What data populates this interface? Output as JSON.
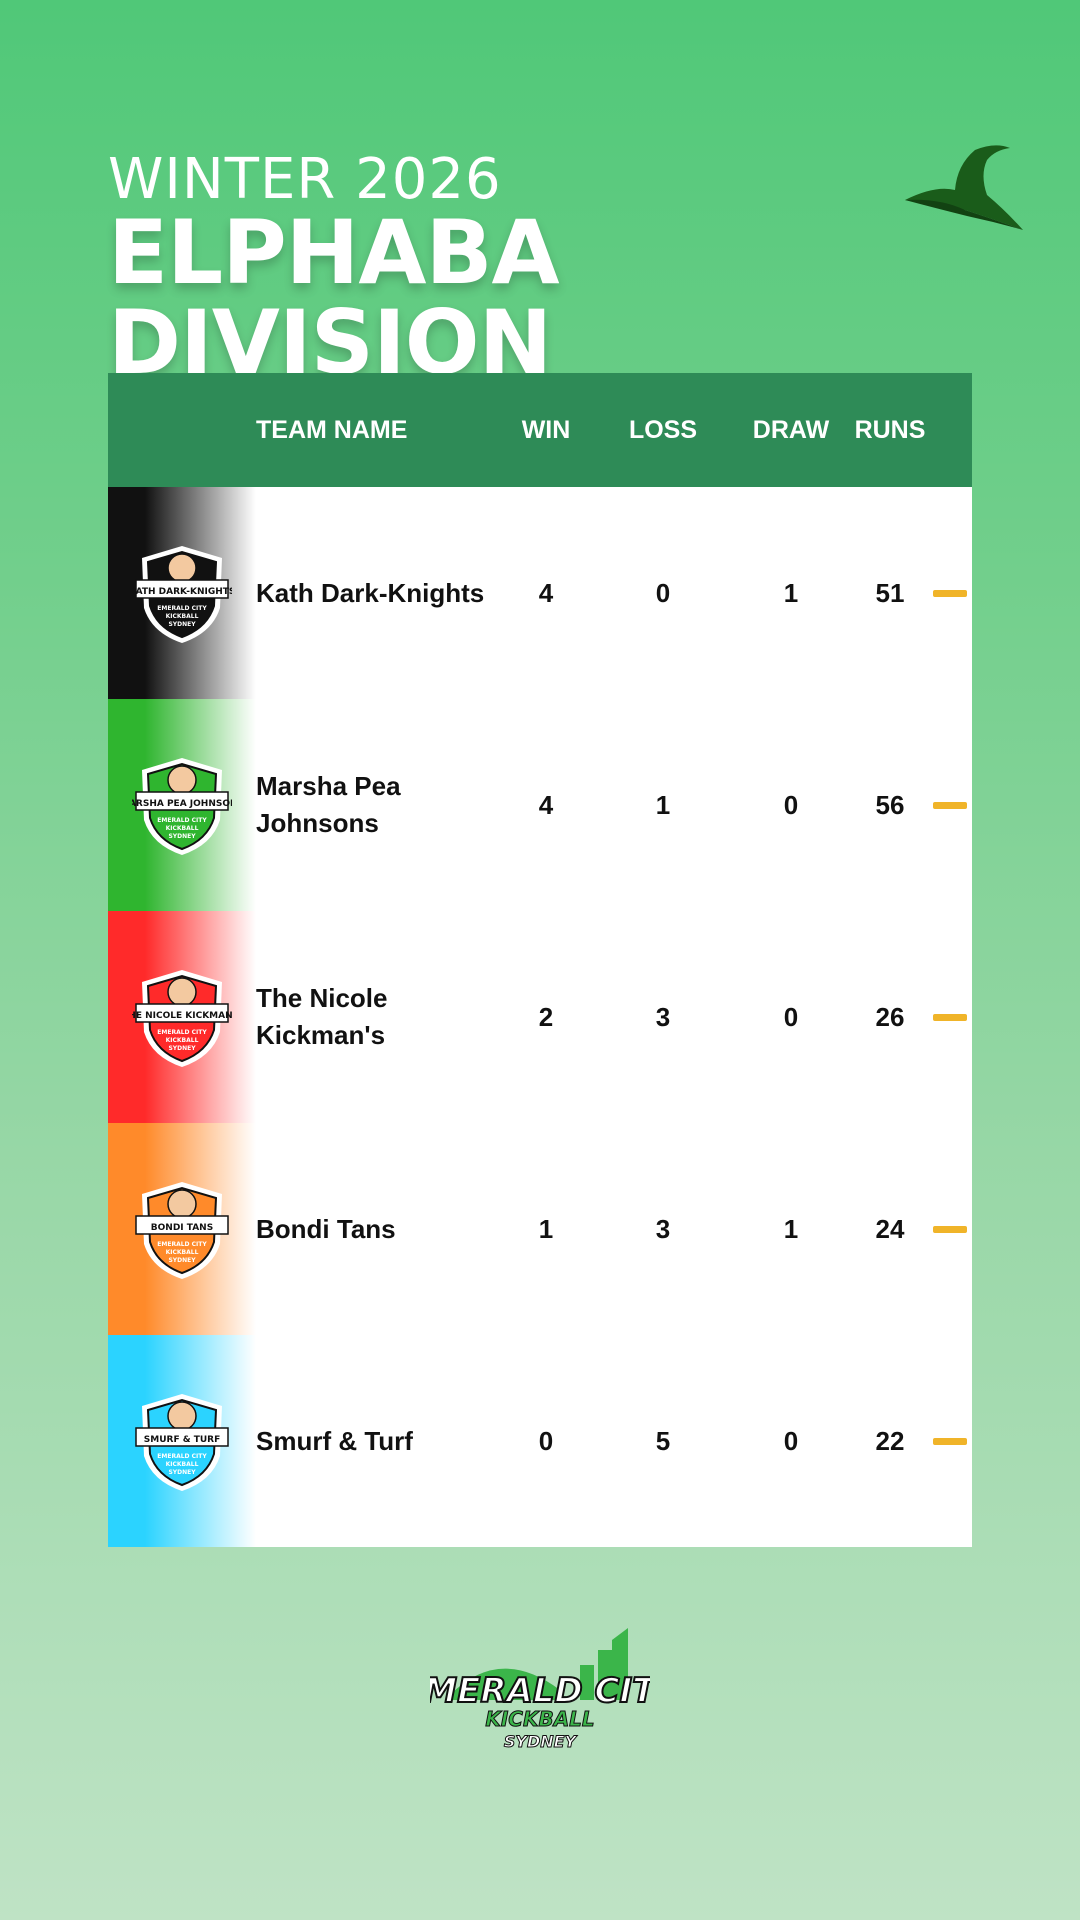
{
  "header": {
    "season": "WINTER 2026",
    "division": "ELPHABA DIVISION",
    "hat_icon": "witch-hat-icon"
  },
  "table": {
    "columns": [
      "TEAM NAME",
      "WIN",
      "LOSS",
      "DRAW",
      "RUNS"
    ],
    "rows": [
      {
        "team": "Kath Dark-Knights",
        "win": "4",
        "loss": "0",
        "draw": "1",
        "runs": "51",
        "logo_text": "KATH DARK-KNIGHTS",
        "color": "#111111",
        "trend": "no-change"
      },
      {
        "team": "Marsha Pea Johnsons",
        "win": "4",
        "loss": "1",
        "draw": "0",
        "runs": "56",
        "logo_text": "MARSHA PEA JOHNSONS",
        "color": "#2fb52f",
        "trend": "no-change"
      },
      {
        "team": "The Nicole Kickman's",
        "win": "2",
        "loss": "3",
        "draw": "0",
        "runs": "26",
        "logo_text": "THE NICOLE KICKMAN'S",
        "color": "#ff2a2a",
        "trend": "no-change"
      },
      {
        "team": "Bondi Tans",
        "win": "1",
        "loss": "3",
        "draw": "1",
        "runs": "24",
        "logo_text": "BONDI TANS",
        "color": "#ff8a2a",
        "trend": "no-change"
      },
      {
        "team": "Smurf & Turf",
        "win": "0",
        "loss": "5",
        "draw": "0",
        "runs": "22",
        "logo_text": "SMURF & TURF",
        "color": "#2bd3ff",
        "trend": "no-change"
      }
    ]
  },
  "badge_subtext": [
    "EMERALD CITY",
    "KICKBALL",
    "SYDNEY"
  ],
  "footer": {
    "logo_line1": "EMERALD CITY",
    "logo_line2": "KICKBALL",
    "logo_line3": "SYDNEY"
  },
  "colors": {
    "header_bg": "#2e8b57",
    "trend_bar": "#f0b429",
    "page_gradient_top": "#50c878",
    "page_gradient_bottom": "#bfe3c5"
  }
}
